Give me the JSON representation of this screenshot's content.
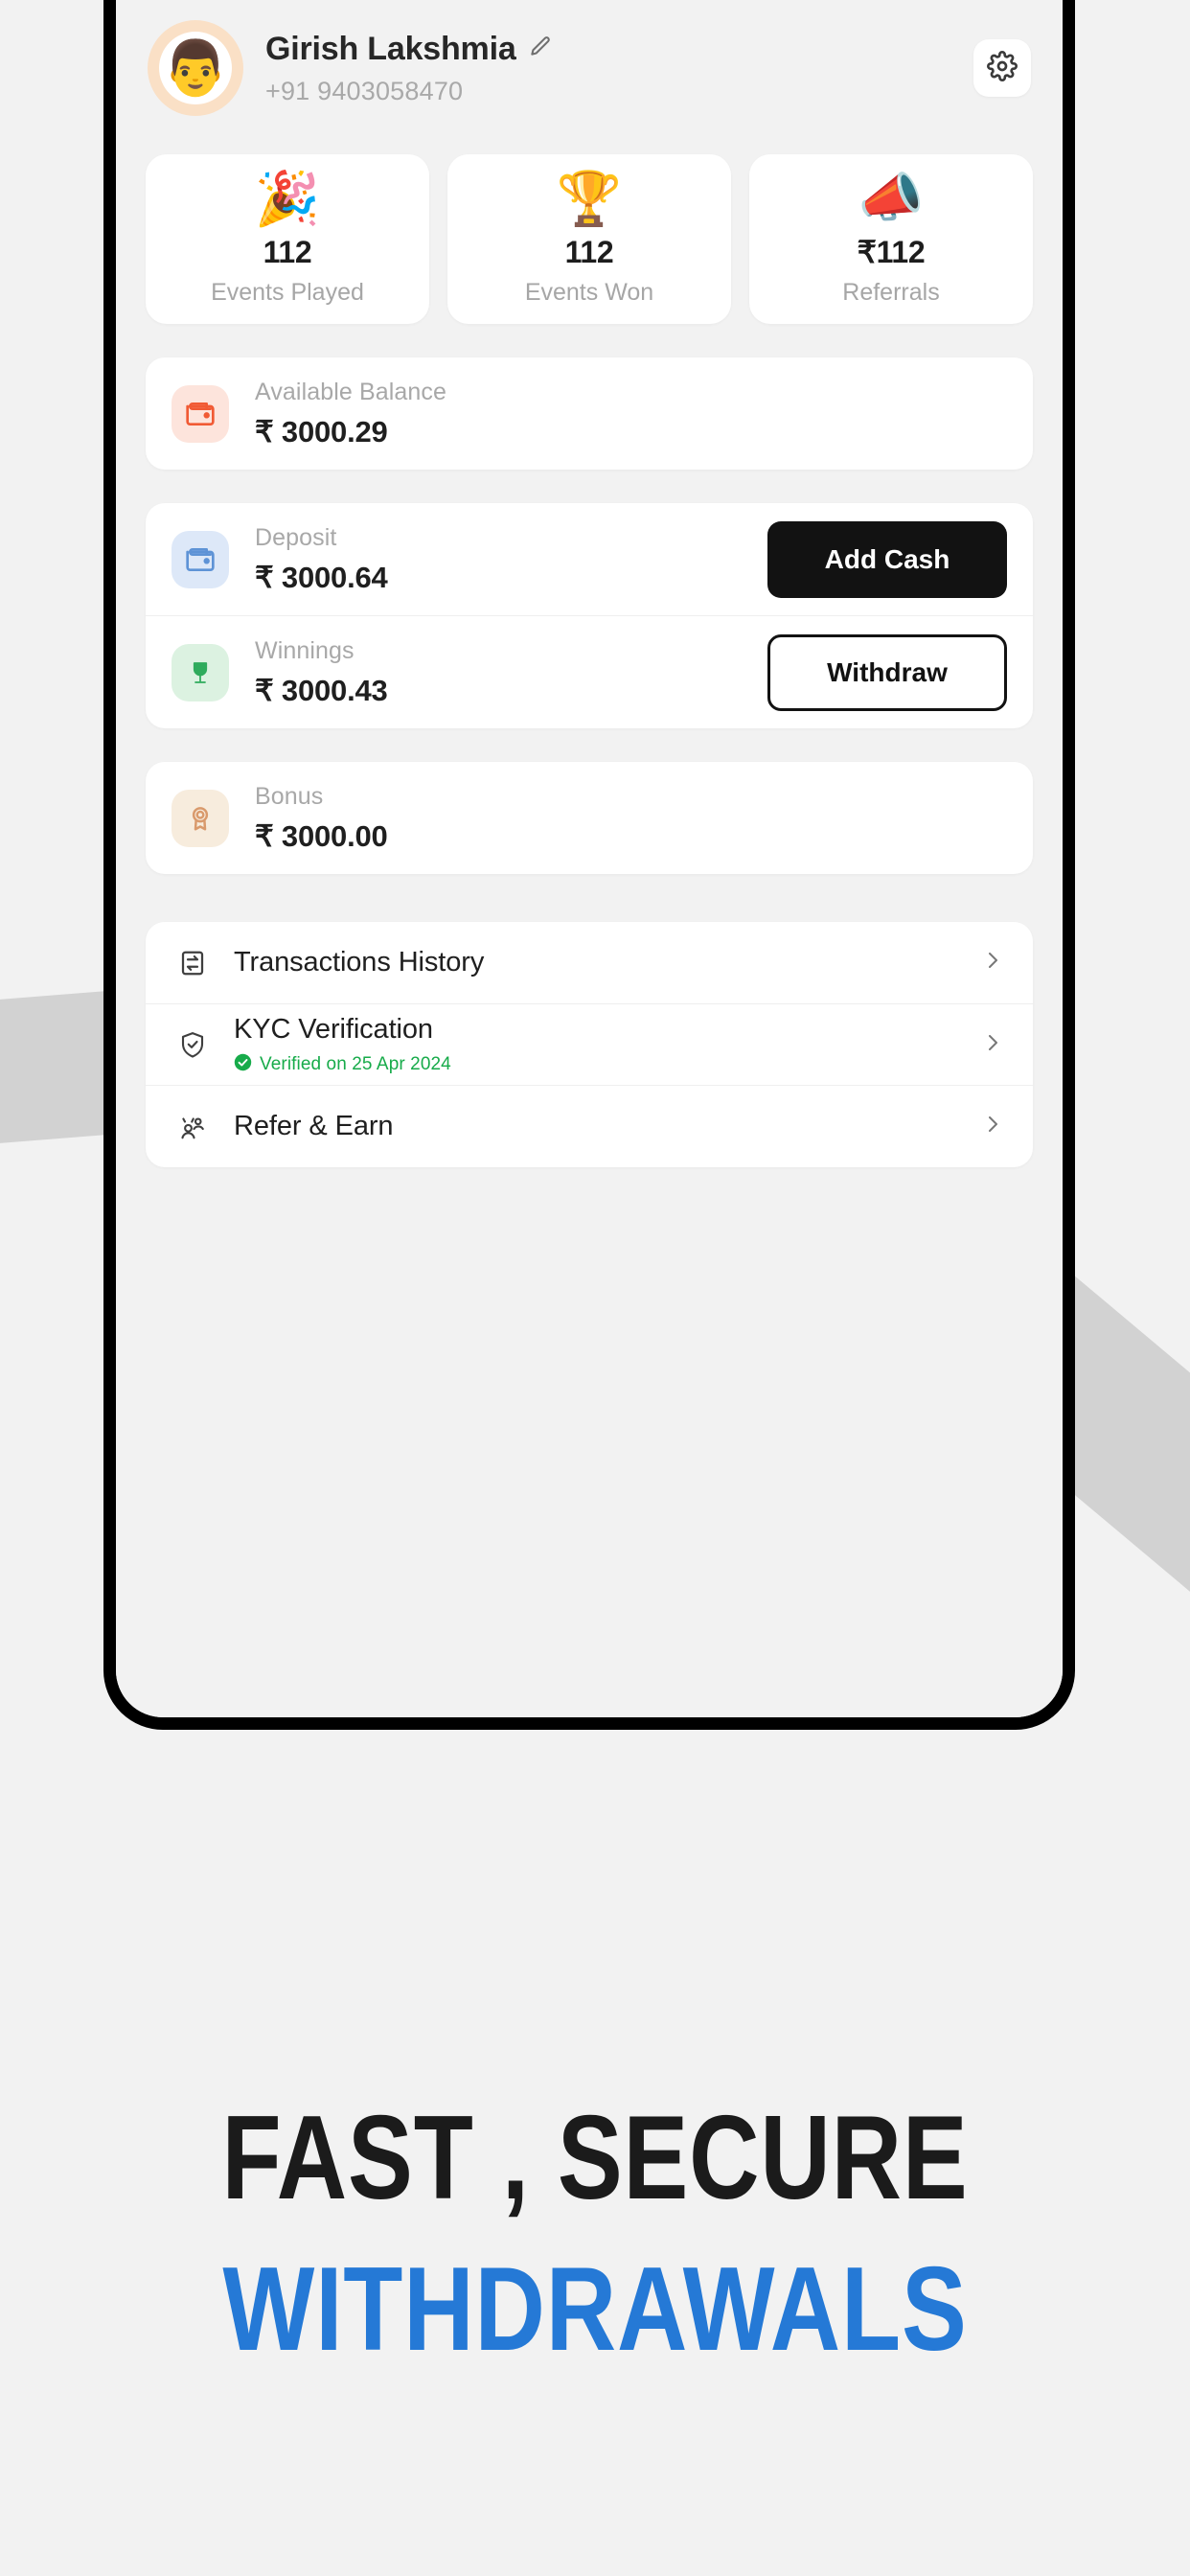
{
  "app": {
    "background_color": "#f2f2f2",
    "accent_blue": "#2579d6",
    "accent_dark": "#121212"
  },
  "profile": {
    "avatar_icon": "man-with-glasses-avatar",
    "name": "Girish Lakshmia",
    "phone": "+91 9403058470",
    "edit_icon": "pencil-icon",
    "settings_icon": "gear-icon"
  },
  "stats": [
    {
      "icon": "party-popper-emoji",
      "emoji": "🎉",
      "value": "112",
      "label": "Events Played"
    },
    {
      "icon": "trophy-emoji",
      "emoji": "🏆",
      "value": "112",
      "label": "Events Won"
    },
    {
      "icon": "megaphone-phone-emoji",
      "emoji": "📣",
      "value": "₹112",
      "label": "Referrals"
    }
  ],
  "available_balance": {
    "icon": "wallet-icon",
    "icon_color": "#f15a34",
    "icon_bg": "#fde4dc",
    "label": "Available Balance",
    "amount": "₹ 3000.29"
  },
  "wallet_rows": [
    {
      "icon": "wallet-icon",
      "icon_color": "#5e93d6",
      "icon_bg": "#dde8f8",
      "label": "Deposit",
      "amount": "₹ 3000.64",
      "action_label": "Add Cash",
      "action_style": "filled"
    },
    {
      "icon": "trophy-icon",
      "icon_color": "#2fab5c",
      "icon_bg": "#dcf2e1",
      "label": "Winnings",
      "amount": "₹ 3000.43",
      "action_label": "Withdraw",
      "action_style": "outline"
    }
  ],
  "bonus": {
    "icon": "medal-icon",
    "icon_color": "#d99a6c",
    "icon_bg": "#f7ecdd",
    "label": "Bonus",
    "amount": "₹ 3000.00"
  },
  "menu": [
    {
      "icon": "transactions-exchange-icon",
      "label": "Transactions History",
      "sub": null,
      "chevron": "chevron-right-icon"
    },
    {
      "icon": "shield-check-icon",
      "label": "KYC Verification",
      "sub": "Verified on 25 Apr 2024",
      "sub_icon": "verified-check-badge-icon",
      "sub_color": "#17ab4a",
      "chevron": "chevron-right-icon"
    },
    {
      "icon": "refer-people-icon",
      "label": "Refer & Earn",
      "sub": null,
      "chevron": "chevron-right-icon"
    }
  ],
  "headline": {
    "line1": "FAST , SECURE",
    "line2": "WITHDRAWALS"
  }
}
